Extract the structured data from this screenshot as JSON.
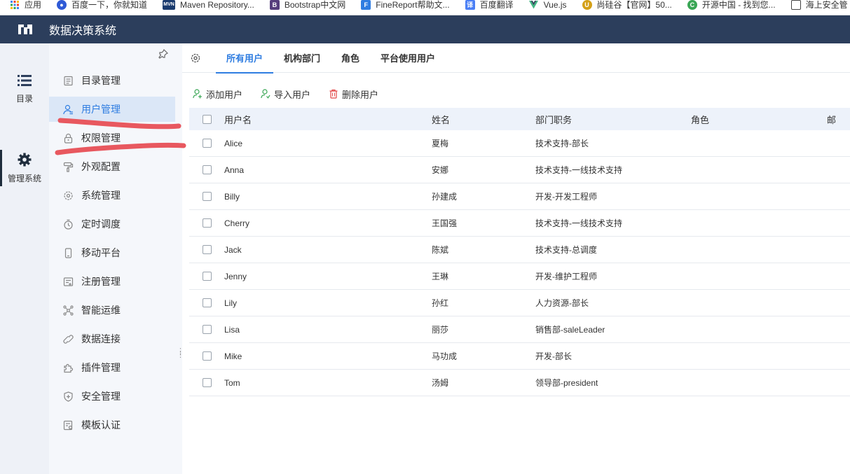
{
  "bookmarks": [
    {
      "label": "应用",
      "icon": "apps-grid-icon",
      "color": "#4285f4"
    },
    {
      "label": "百度一下，你就知道",
      "icon": "baidu-paw-icon",
      "color": "#2f5ad6"
    },
    {
      "label": "Maven Repository...",
      "icon": "mvn-logo-icon",
      "color": "#1a3b6f"
    },
    {
      "label": "Bootstrap中文网",
      "icon": "bootstrap-b-icon",
      "color": "#563d7c"
    },
    {
      "label": "FineReport帮助文...",
      "icon": "finereport-logo-icon",
      "color": "#2f7de1"
    },
    {
      "label": "百度翻译",
      "icon": "baidu-translate-icon",
      "color": "#4a7ff5"
    },
    {
      "label": "Vue.js",
      "icon": "vue-logo-icon",
      "color": "#41b883"
    },
    {
      "label": "尚硅谷【官网】50...",
      "icon": "atguigu-logo-icon",
      "color": "#d4a017"
    },
    {
      "label": "开源中国 - 找到您...",
      "icon": "oschina-logo-icon",
      "color": "#3aa655"
    },
    {
      "label": "海上安全管",
      "icon": "page-icon",
      "color": "#444444"
    }
  ],
  "app": {
    "title": "数据决策系统"
  },
  "rail": {
    "items": [
      {
        "label": "目录",
        "icon": "list-icon"
      },
      {
        "label": "管理系统",
        "icon": "gear-icon"
      }
    ]
  },
  "menu": {
    "items": [
      {
        "label": "目录管理",
        "icon": "directory-icon"
      },
      {
        "label": "用户管理",
        "icon": "user-icon"
      },
      {
        "label": "权限管理",
        "icon": "lock-icon"
      },
      {
        "label": "外观配置",
        "icon": "paint-roller-icon"
      },
      {
        "label": "系统管理",
        "icon": "settings-icon"
      },
      {
        "label": "定时调度",
        "icon": "timer-icon"
      },
      {
        "label": "移动平台",
        "icon": "mobile-icon"
      },
      {
        "label": "注册管理",
        "icon": "register-icon"
      },
      {
        "label": "智能运维",
        "icon": "network-icon"
      },
      {
        "label": "数据连接",
        "icon": "link-icon"
      },
      {
        "label": "插件管理",
        "icon": "puzzle-icon"
      },
      {
        "label": "安全管理",
        "icon": "shield-icon"
      },
      {
        "label": "模板认证",
        "icon": "certificate-icon"
      }
    ],
    "active_index": 1
  },
  "tabs": [
    {
      "label": "所有用户"
    },
    {
      "label": "机构部门"
    },
    {
      "label": "角色"
    },
    {
      "label": "平台使用用户"
    }
  ],
  "toolbar": {
    "add": "添加用户",
    "import": "导入用户",
    "delete": "删除用户"
  },
  "table": {
    "headers": {
      "username": "用户名",
      "name": "姓名",
      "dept": "部门职务",
      "role": "角色",
      "extra": "邮"
    },
    "rows": [
      {
        "username": "Alice",
        "name": "夏梅",
        "dept": "技术支持-部长",
        "role": ""
      },
      {
        "username": "Anna",
        "name": "安娜",
        "dept": "技术支持-一线技术支持",
        "role": ""
      },
      {
        "username": "Billy",
        "name": "孙建成",
        "dept": "开发-开发工程师",
        "role": ""
      },
      {
        "username": "Cherry",
        "name": "王国强",
        "dept": "技术支持-一线技术支持",
        "role": ""
      },
      {
        "username": "Jack",
        "name": "陈斌",
        "dept": "技术支持-总调度",
        "role": ""
      },
      {
        "username": "Jenny",
        "name": "王琳",
        "dept": "开发-维护工程师",
        "role": ""
      },
      {
        "username": "Lily",
        "name": "孙红",
        "dept": "人力资源-部长",
        "role": ""
      },
      {
        "username": "Lisa",
        "name": "丽莎",
        "dept": "销售部-saleLeader",
        "role": ""
      },
      {
        "username": "Mike",
        "name": "马功成",
        "dept": "开发-部长",
        "role": ""
      },
      {
        "username": "Tom",
        "name": "汤姆",
        "dept": "领导部-president",
        "role": ""
      }
    ]
  },
  "colors": {
    "accent": "#2f7de1",
    "header_bg": "#2c3e5c",
    "marker": "#e8585f"
  }
}
